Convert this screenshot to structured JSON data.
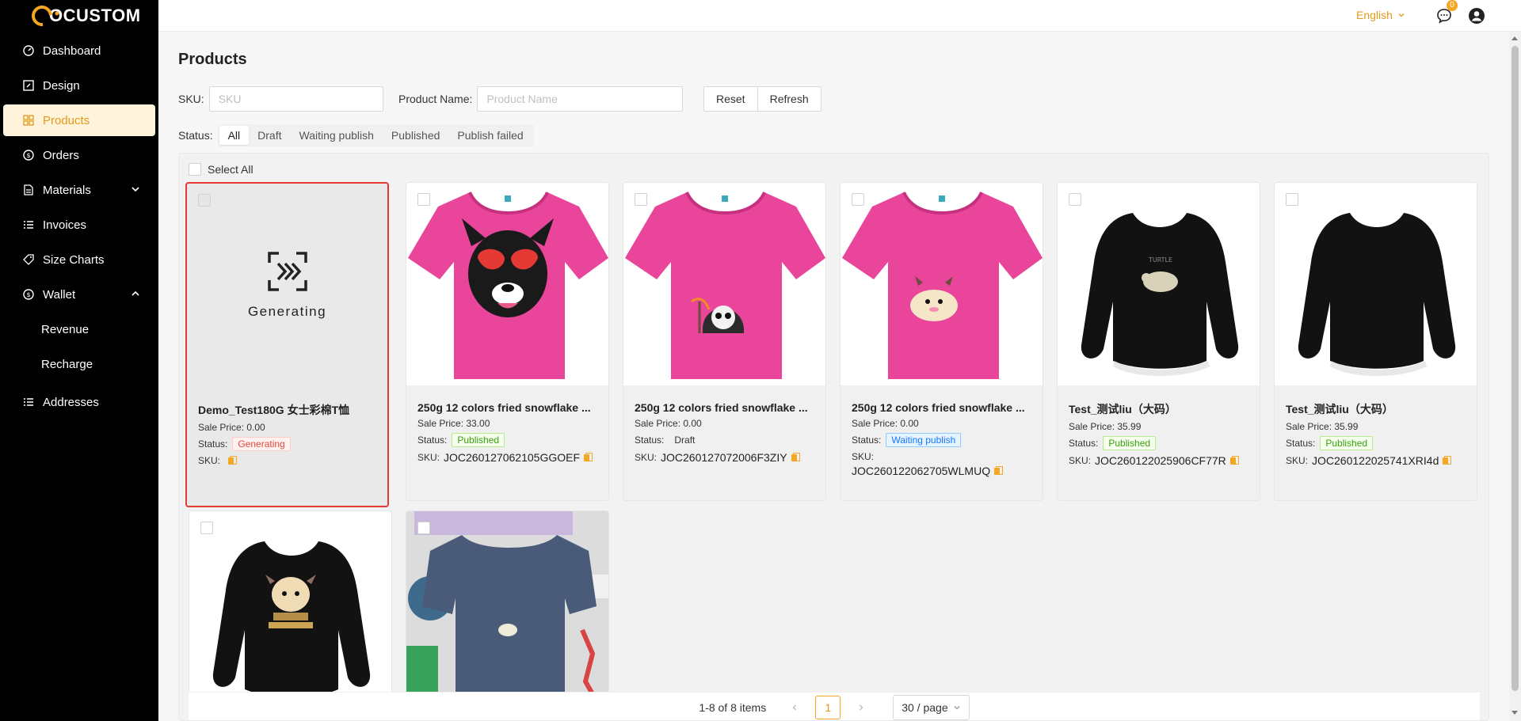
{
  "brand": {
    "name": "OCUSTOM",
    "accent": "#f5a623"
  },
  "sidebar": {
    "items": [
      {
        "label": "Dashboard",
        "icon": "dashboard-icon"
      },
      {
        "label": "Design",
        "icon": "design-icon"
      },
      {
        "label": "Products",
        "icon": "products-icon",
        "active": true
      },
      {
        "label": "Orders",
        "icon": "orders-icon"
      },
      {
        "label": "Materials",
        "icon": "materials-icon"
      },
      {
        "label": "Invoices",
        "icon": "invoices-icon"
      },
      {
        "label": "Size Charts",
        "icon": "tag-icon"
      },
      {
        "label": "Wallet",
        "icon": "wallet-icon"
      }
    ],
    "wallet_sub": [
      "Revenue",
      "Recharge"
    ],
    "addresses": "Addresses"
  },
  "topbar": {
    "language": "English",
    "message_count": "0"
  },
  "page": {
    "title": "Products"
  },
  "filters": {
    "sku_label": "SKU:",
    "sku_placeholder": "SKU",
    "name_label": "Product Name:",
    "name_placeholder": "Product Name",
    "reset": "Reset",
    "refresh": "Refresh"
  },
  "status_filter": {
    "label": "Status:",
    "options": [
      "All",
      "Draft",
      "Waiting publish",
      "Published",
      "Publish failed"
    ],
    "selected": "All"
  },
  "select_all": "Select All",
  "cards": [
    {
      "name": "Demo_Test180G 女士彩棉T恤",
      "price_label": "Sale Price:",
      "price": "0.00",
      "status_label": "Status:",
      "status": "Generating",
      "sku_label": "SKU:",
      "sku": "",
      "overlay_text": "Generating"
    },
    {
      "name": "250g 12 colors fried snowflake ...",
      "price_label": "Sale Price:",
      "price": "33.00",
      "status_label": "Status:",
      "status": "Published",
      "sku_label": "SKU:",
      "sku": "JOC260127062105GGOEF"
    },
    {
      "name": "250g 12 colors fried snowflake ...",
      "price_label": "Sale Price:",
      "price": "0.00",
      "status_label": "Status:",
      "status": "Draft",
      "sku_label": "SKU:",
      "sku": "JOC260127072006F3ZIY"
    },
    {
      "name": "250g 12 colors fried snowflake ...",
      "price_label": "Sale Price:",
      "price": "0.00",
      "status_label": "Status:",
      "status": "Waiting publish",
      "sku_label": "SKU:",
      "sku": "JOC260122062705WLMUQ"
    },
    {
      "name": "Test_测试liu（大码）",
      "price_label": "Sale Price:",
      "price": "35.99",
      "status_label": "Status:",
      "status": "Published",
      "sku_label": "SKU:",
      "sku": "JOC260122025906CF77R"
    },
    {
      "name": "Test_测试liu（大码）",
      "price_label": "Sale Price:",
      "price": "35.99",
      "status_label": "Status:",
      "status": "Published",
      "sku_label": "SKU:",
      "sku": "JOC260122025741XRI4d"
    }
  ],
  "pagination": {
    "summary": "1-8 of 8 items",
    "page": "1",
    "page_size": "30 / page"
  },
  "colors": {
    "published": "#389e0d",
    "generating": "#e04a3a",
    "waiting": "#1677ff"
  }
}
